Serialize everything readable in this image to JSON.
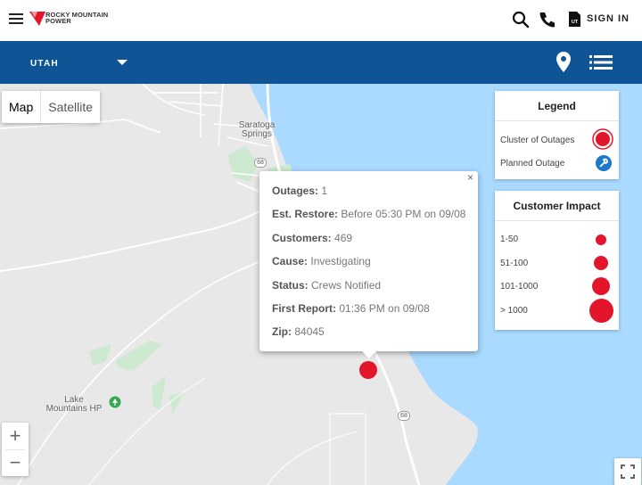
{
  "header": {
    "logo_text": "ROCKY MOUNTAIN POWER",
    "logo_line1": "ROCKY MOUNTAIN",
    "logo_line2": "POWER",
    "signin_label": "SIGN IN",
    "icons": [
      "menu-icon",
      "search-icon",
      "phone-icon",
      "utility-account-icon"
    ],
    "brand_color": "#e3152a"
  },
  "state_bar": {
    "selected_state": "UTAH",
    "icons": [
      "location-pin-icon",
      "list-icon"
    ],
    "bar_color": "#0f5596"
  },
  "map": {
    "type_buttons": [
      "Map",
      "Satellite"
    ],
    "active_type": "Map",
    "places": [
      {
        "name": "Saratoga Springs"
      },
      {
        "name": "Lake Mountains HP"
      }
    ],
    "route_label": "68",
    "zoom_in": "+",
    "zoom_out": "−",
    "water_color": "#aadaff",
    "land_color": "#e8e8e8"
  },
  "popup": {
    "close_label": "×",
    "rows": [
      {
        "key": "Outages:",
        "value": "1"
      },
      {
        "key": "Est. Restore:",
        "value": "Before 05:30 PM on 09/08"
      },
      {
        "key": "Customers:",
        "value": "469"
      },
      {
        "key": "Cause:",
        "value": "Investigating"
      },
      {
        "key": "Status:",
        "value": "Crews Notified"
      },
      {
        "key": "First Report:",
        "value": "01:36 PM on 09/08"
      },
      {
        "key": "Zip:",
        "value": "84045"
      }
    ]
  },
  "legend": {
    "title": "Legend",
    "items": [
      {
        "label": "Cluster of Outages",
        "icon": "cluster-icon"
      },
      {
        "label": "Planned Outage",
        "icon": "planned-outage-icon"
      }
    ]
  },
  "impact": {
    "title": "Customer Impact",
    "items": [
      {
        "label": "1-50"
      },
      {
        "label": "51-100"
      },
      {
        "label": "101-1000"
      },
      {
        "label": "> 1000"
      }
    ],
    "dot_color": "#e3152a"
  }
}
